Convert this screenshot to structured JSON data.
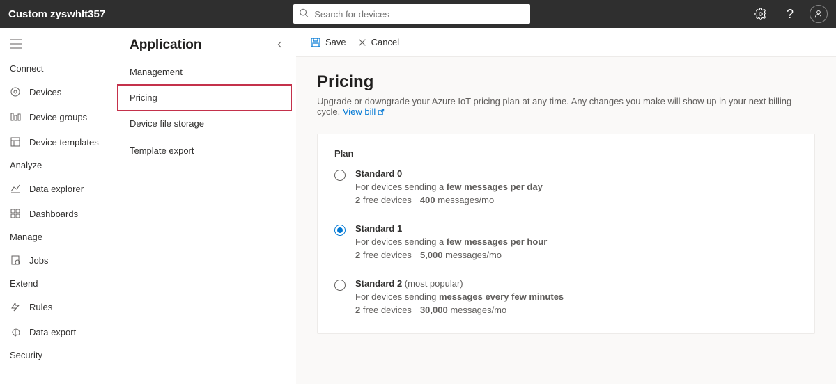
{
  "topbar": {
    "app_title": "Custom zyswhlt357",
    "search_placeholder": "Search for devices"
  },
  "leftnav": {
    "sections": [
      {
        "label": "Connect",
        "items": [
          {
            "label": "Devices",
            "icon": "devices-icon"
          },
          {
            "label": "Device groups",
            "icon": "device-groups-icon"
          },
          {
            "label": "Device templates",
            "icon": "device-templates-icon"
          }
        ]
      },
      {
        "label": "Analyze",
        "items": [
          {
            "label": "Data explorer",
            "icon": "data-explorer-icon"
          },
          {
            "label": "Dashboards",
            "icon": "dashboards-icon"
          }
        ]
      },
      {
        "label": "Manage",
        "items": [
          {
            "label": "Jobs",
            "icon": "jobs-icon"
          }
        ]
      },
      {
        "label": "Extend",
        "items": [
          {
            "label": "Rules",
            "icon": "rules-icon"
          },
          {
            "label": "Data export",
            "icon": "data-export-icon"
          }
        ]
      },
      {
        "label": "Security",
        "items": []
      }
    ]
  },
  "subnav": {
    "title": "Application",
    "items": [
      {
        "label": "Management",
        "active": false
      },
      {
        "label": "Pricing",
        "active": true
      },
      {
        "label": "Device file storage",
        "active": false
      },
      {
        "label": "Template export",
        "active": false
      }
    ]
  },
  "toolbar": {
    "save_label": "Save",
    "cancel_label": "Cancel"
  },
  "page": {
    "title": "Pricing",
    "subtitle_a": "Upgrade or downgrade your Azure IoT pricing plan at any time. Any changes you make will show up in your next billing cycle. ",
    "view_bill": "View bill"
  },
  "card": {
    "title": "Plan",
    "plans": [
      {
        "name": "Standard 0",
        "tag": "",
        "desc_prefix": "For devices sending a ",
        "desc_bold": "few messages per day",
        "free_count": "2",
        "free_label": " free devices",
        "msg_count": "400",
        "msg_label": " messages/mo",
        "selected": false
      },
      {
        "name": "Standard 1",
        "tag": "",
        "desc_prefix": "For devices sending a ",
        "desc_bold": "few messages per hour",
        "free_count": "2",
        "free_label": " free devices",
        "msg_count": "5,000",
        "msg_label": " messages/mo",
        "selected": true
      },
      {
        "name": "Standard 2",
        "tag": " (most popular)",
        "desc_prefix": "For devices sending ",
        "desc_bold": "messages every few minutes",
        "free_count": "2",
        "free_label": " free devices",
        "msg_count": "30,000",
        "msg_label": " messages/mo",
        "selected": false
      }
    ]
  }
}
